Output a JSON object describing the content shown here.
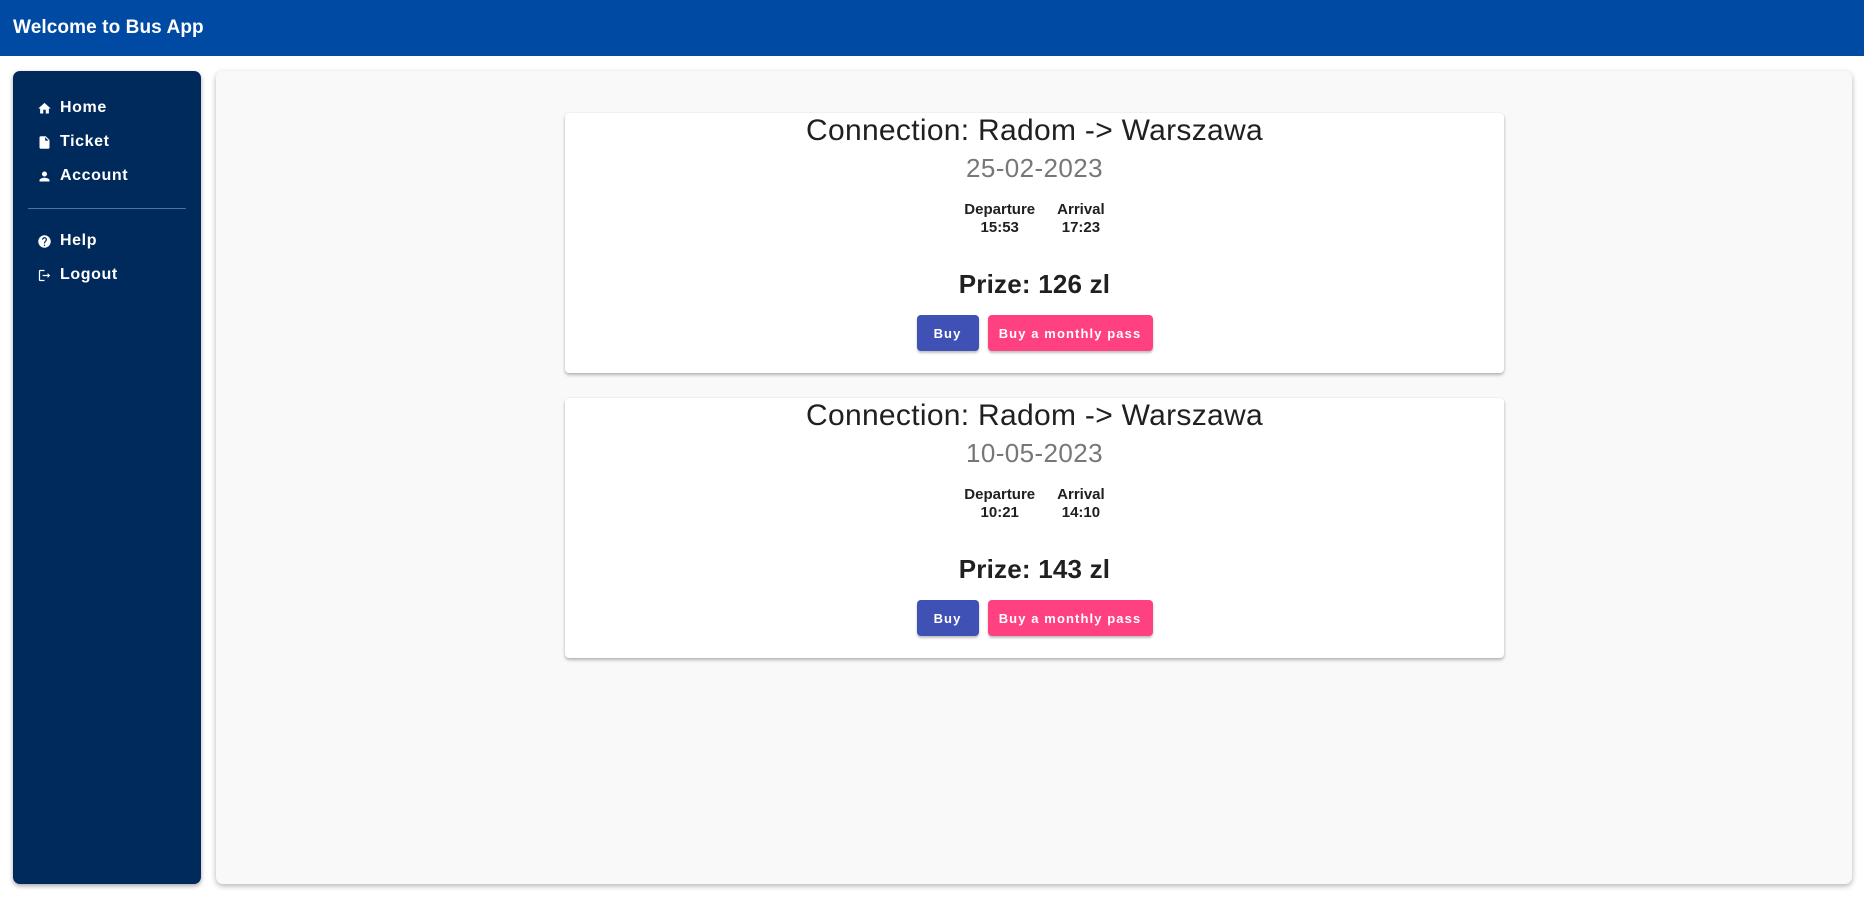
{
  "app": {
    "title": "Welcome to Bus App"
  },
  "sidebar": {
    "items": [
      {
        "label": "Home",
        "icon": "home-icon"
      },
      {
        "label": "Ticket",
        "icon": "document-icon"
      },
      {
        "label": "Account",
        "icon": "person-icon"
      }
    ],
    "secondary_items": [
      {
        "label": "Help",
        "icon": "help-icon"
      },
      {
        "label": "Logout",
        "icon": "logout-icon"
      }
    ]
  },
  "connections": [
    {
      "title": "Connection: Radom -> Warszawa",
      "date": "25-02-2023",
      "departure_label": "Departure",
      "departure_time": "15:53",
      "arrival_label": "Arrival",
      "arrival_time": "17:23",
      "price": "Prize: 126 zl",
      "buy_label": "Buy",
      "pass_label": "Buy a monthly pass"
    },
    {
      "title": "Connection: Radom -> Warszawa",
      "date": "10-05-2023",
      "departure_label": "Departure",
      "departure_time": "10:21",
      "arrival_label": "Arrival",
      "arrival_time": "14:10",
      "price": "Prize: 143 zl",
      "buy_label": "Buy",
      "pass_label": "Buy a monthly pass"
    }
  ],
  "colors": {
    "topbar": "#004aa3",
    "sidebar": "#002a5c",
    "primary_button": "#3f51b5",
    "accent_button": "#ff4081"
  }
}
